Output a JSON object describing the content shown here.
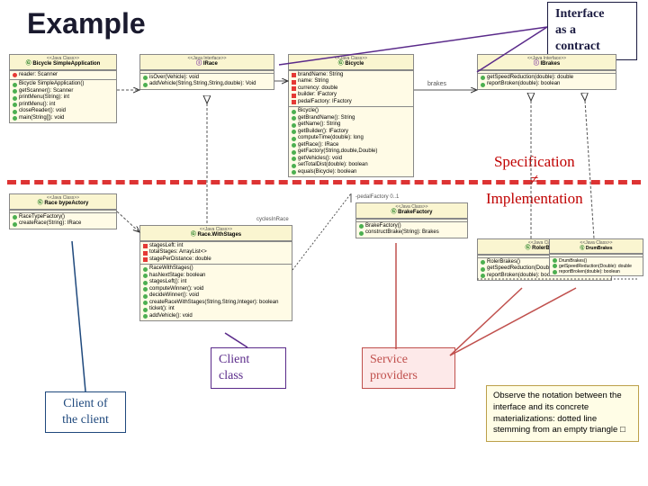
{
  "title": "Example",
  "callouts": {
    "interface_contract": "Interface\nas a\ncontract",
    "spec_line1": "Specification",
    "spec_neq": "≠",
    "spec_line2": "Implementation",
    "client_class": "Client\nclass",
    "service_providers": "Service\nproviders",
    "client_of_client": "Client of\nthe client"
  },
  "observe_note": "Observe the notation between the interface and its concrete materializations: dotted line stemming from an empty triangle □",
  "uml": {
    "simpleApp": {
      "stereo": "<<Java Class>>",
      "name": "Bicycle SimpleApplication",
      "attrs": [
        "reader: Scanner"
      ],
      "ops": [
        "Bicycle SimpleApplication()",
        "getScanner(): Scanner",
        "printMenu(String): int",
        "printMenu(): int",
        "closeReader(): void",
        "main(String[]): void"
      ]
    },
    "irace": {
      "stereo": "<<Java Interface>>",
      "name": "IRace",
      "ops": [
        "isOver(Vehicle): void",
        "addVehicle(String,String,String,double): Void"
      ]
    },
    "ibicycle": {
      "stereo": "<<Java Class>>",
      "name": "Bicycle",
      "attrs": [
        "brandName: String",
        "name: String",
        "currency: double",
        "builder: IFactory",
        "pedalFactory: IFactory"
      ],
      "ops": [
        "Bicycle()",
        "getBrandName(): String",
        "getName(): String",
        "getBuilder(): IFactory",
        "computeTime(double): long",
        "getRace(): IRace",
        "getFactory(String,double,Double)",
        "getVehicles(): void",
        "setTotalDist(double): boolean",
        "equals(Bicycle): boolean"
      ]
    },
    "ibrakes": {
      "stereo": "<<Java Interface>>",
      "name": "IBrakes",
      "ops": [
        "getSpeedReduction(double): double",
        "reportBroken(double): boolean"
      ]
    },
    "raceTypeFactory": {
      "stereo": "<<Java Class>>",
      "name": "Race bypeActory",
      "ops": [
        "RaceTypeFactory()",
        "createRace(String): IRace"
      ]
    },
    "raceWithStages": {
      "stereo": "<<Java Class>>",
      "name": "Race.WithStages",
      "attrs": [
        "stagesLeft: int",
        "totalStages: ArrayList<>",
        "stagePerDistance: double"
      ],
      "ops": [
        "RaceWithStages()",
        "hasNextStage: boolean",
        "stagesLeft(): int",
        "computeWinner(): void",
        "decideWinner(): void",
        "createRaceWithStages(String,String,Integer): boolean",
        "ticket(): int",
        "addVehicle(): void"
      ]
    },
    "brakeFactory": {
      "stereo": "<<Java Class>>",
      "name": "BrakeFactory",
      "ops": [
        "BrakeFactory()",
        "constructBrake(String): Brakes"
      ]
    },
    "rolerbrakes": {
      "stereo": "<<Java Class>>",
      "name": "RolerBrakes",
      "ops": [
        "RolerBrakes()",
        "getSpeedReduction(Double): double",
        "reportBroken(double): boolean"
      ]
    },
    "drumbrakes": {
      "stereo": "<<Java Class>>",
      "name": "DrumBrakes",
      "ops": [
        "DrumBrakes()",
        "getSpeedReduction(Double): double",
        "reportBroken(double): boolean"
      ]
    }
  },
  "labels": {
    "brakes": "brakes",
    "pedalFactory": "-pedalFactory 0..1",
    "cyclesInRace": "cyclesInRace"
  }
}
